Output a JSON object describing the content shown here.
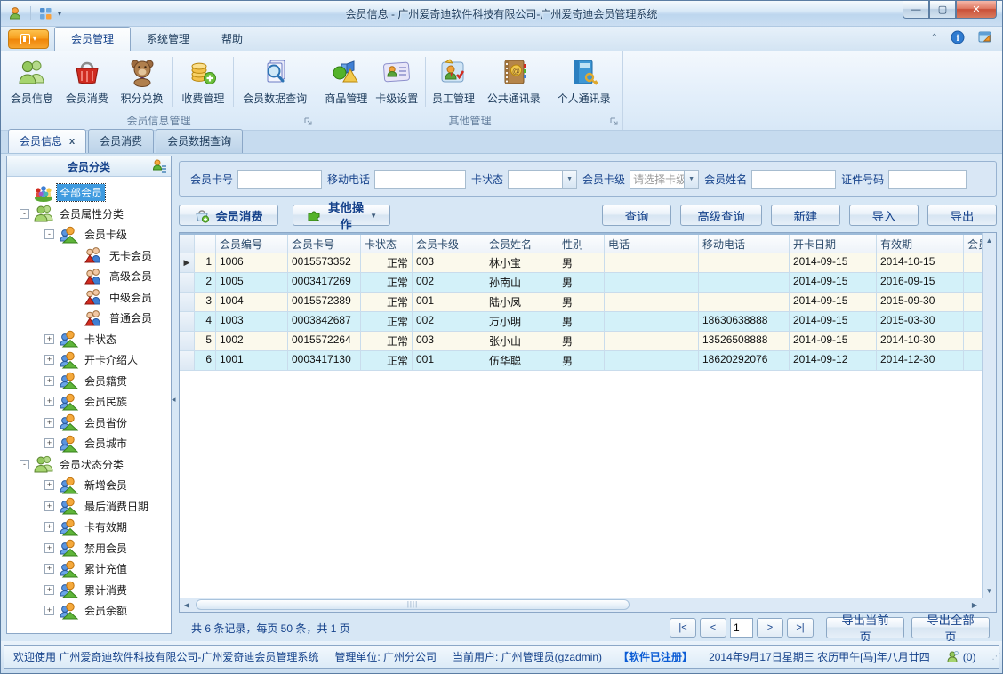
{
  "window": {
    "title": "会员信息 - 广州爱奇迪软件科技有限公司-广州爱奇迪会员管理系统"
  },
  "window_controls": {
    "minimize": "—",
    "maximize": "▢",
    "close": "✕"
  },
  "menu": {
    "tabs": [
      {
        "label": "会员管理"
      },
      {
        "label": "系统管理"
      },
      {
        "label": "帮助"
      }
    ]
  },
  "ribbon": {
    "groups": [
      {
        "label": "会员信息管理",
        "buttons": [
          "会员信息",
          "会员消费",
          "积分兑换",
          "收费管理",
          "会员数据查询"
        ]
      },
      {
        "label": "其他管理",
        "buttons": [
          "商品管理",
          "卡级设置",
          "员工管理",
          "公共通讯录",
          "个人通讯录"
        ]
      }
    ]
  },
  "doc_tabs": {
    "tabs": [
      "会员信息",
      "会员消费",
      "会员数据查询"
    ],
    "close_glyph": "x"
  },
  "sidebar": {
    "title": "会员分类",
    "tree": [
      {
        "label": "全部会员",
        "level": 0,
        "icon": "allmembers",
        "selected": true
      },
      {
        "label": "会员属性分类",
        "level": 0,
        "icon": "people-green",
        "toggle": "-"
      },
      {
        "label": "会员卡级",
        "level": 1,
        "icon": "person-orange",
        "toggle": "-"
      },
      {
        "label": "无卡会员",
        "level": 2,
        "icon": "manwoman"
      },
      {
        "label": "高级会员",
        "level": 2,
        "icon": "manwoman"
      },
      {
        "label": "中级会员",
        "level": 2,
        "icon": "manwoman"
      },
      {
        "label": "普通会员",
        "level": 2,
        "icon": "manwoman"
      },
      {
        "label": "卡状态",
        "level": 1,
        "icon": "person-orange",
        "toggle": "+"
      },
      {
        "label": "开卡介绍人",
        "level": 1,
        "icon": "person-orange",
        "toggle": "+"
      },
      {
        "label": "会员籍贯",
        "level": 1,
        "icon": "person-orange",
        "toggle": "+"
      },
      {
        "label": "会员民族",
        "level": 1,
        "icon": "person-orange",
        "toggle": "+"
      },
      {
        "label": "会员省份",
        "level": 1,
        "icon": "person-orange",
        "toggle": "+"
      },
      {
        "label": "会员城市",
        "level": 1,
        "icon": "person-orange",
        "toggle": "+"
      },
      {
        "label": "会员状态分类",
        "level": 0,
        "icon": "people-green",
        "toggle": "-"
      },
      {
        "label": "新增会员",
        "level": 1,
        "icon": "person-orange",
        "toggle": "+"
      },
      {
        "label": "最后消费日期",
        "level": 1,
        "icon": "person-orange",
        "toggle": "+"
      },
      {
        "label": "卡有效期",
        "level": 1,
        "icon": "person-orange",
        "toggle": "+"
      },
      {
        "label": "禁用会员",
        "level": 1,
        "icon": "person-orange",
        "toggle": "+"
      },
      {
        "label": "累计充值",
        "level": 1,
        "icon": "person-orange",
        "toggle": "+"
      },
      {
        "label": "累计消费",
        "level": 1,
        "icon": "person-orange",
        "toggle": "+"
      },
      {
        "label": "会员余额",
        "level": 1,
        "icon": "person-orange",
        "toggle": "+"
      }
    ]
  },
  "search": {
    "fields": [
      {
        "label": "会员卡号",
        "type": "text",
        "value": ""
      },
      {
        "label": "移动电话",
        "type": "text",
        "value": ""
      },
      {
        "label": "卡状态",
        "type": "select",
        "value": ""
      },
      {
        "label": "会员卡级",
        "type": "select",
        "value": "请选择卡级"
      },
      {
        "label": "会员姓名",
        "type": "text",
        "value": ""
      },
      {
        "label": "证件号码",
        "type": "text",
        "value": ""
      }
    ]
  },
  "toolbar": {
    "consume_button": "会员消费",
    "other_ops_button": "其他操作",
    "right_buttons": [
      "查询",
      "高级查询",
      "新建",
      "导入",
      "导出"
    ]
  },
  "table": {
    "columns": [
      "会员编号",
      "会员卡号",
      "卡状态",
      "会员卡级",
      "会员姓名",
      "性别",
      "电话",
      "移动电话",
      "开卡日期",
      "有效期",
      "会员"
    ],
    "rows": [
      {
        "num": "1",
        "cells": [
          "1006",
          "0015573352",
          "正常",
          "003",
          "林小宝",
          "男",
          "",
          "",
          "2014-09-15",
          "2014-10-15",
          ""
        ]
      },
      {
        "num": "2",
        "cells": [
          "1005",
          "0003417269",
          "正常",
          "002",
          "孙南山",
          "男",
          "",
          "",
          "2014-09-15",
          "2016-09-15",
          ""
        ]
      },
      {
        "num": "3",
        "cells": [
          "1004",
          "0015572389",
          "正常",
          "001",
          "陆小凤",
          "男",
          "",
          "",
          "2014-09-15",
          "2015-09-30",
          ""
        ]
      },
      {
        "num": "4",
        "cells": [
          "1003",
          "0003842687",
          "正常",
          "002",
          "万小明",
          "男",
          "",
          "18630638888",
          "2014-09-15",
          "2015-03-30",
          ""
        ]
      },
      {
        "num": "5",
        "cells": [
          "1002",
          "0015572264",
          "正常",
          "003",
          "张小山",
          "男",
          "",
          "13526508888",
          "2014-09-15",
          "2014-10-30",
          ""
        ]
      },
      {
        "num": "6",
        "cells": [
          "1001",
          "0003417130",
          "正常",
          "001",
          "伍华聪",
          "男",
          "",
          "18620292076",
          "2014-09-12",
          "2014-12-30",
          ""
        ]
      }
    ],
    "selected_row_marker": "▶"
  },
  "pager": {
    "summary": "共 6 条记录，每页 50 条，共 1 页",
    "first": "|<",
    "prev": "<",
    "page": "1",
    "next": ">",
    "last": ">|",
    "export_current": "导出当前页",
    "export_all": "导出全部页"
  },
  "statusbar": {
    "welcome": "欢迎使用 广州爱奇迪软件科技有限公司-广州爱奇迪会员管理系统",
    "unit": "管理单位: 广州分公司",
    "user": "当前用户: 广州管理员(gzadmin)",
    "registered": "【软件已注册】",
    "date": "2014年9月17日星期三 农历甲午[马]年八月廿四",
    "msg_count": "(0)"
  }
}
